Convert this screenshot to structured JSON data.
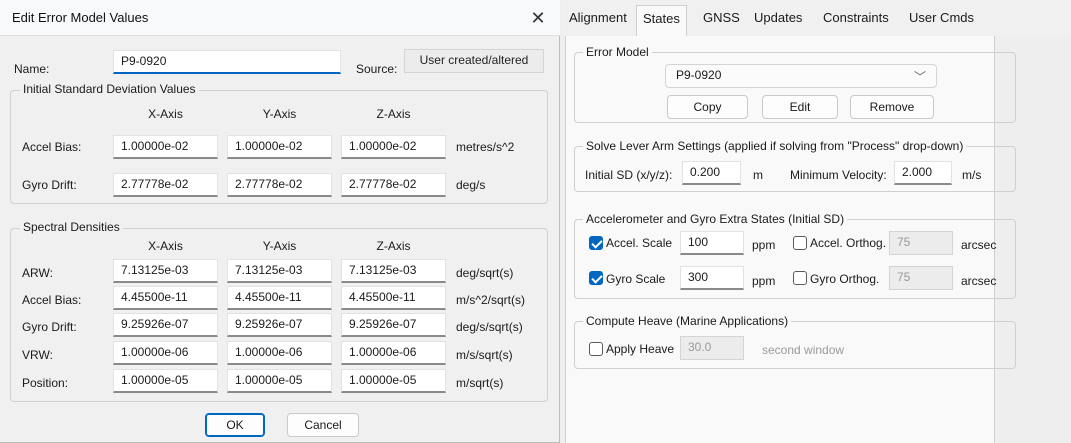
{
  "dialog": {
    "title": "Edit Error Model Values",
    "close_glyph": "✕",
    "name_label": "Name:",
    "name_value": "P9-0920",
    "source_label": "Source:",
    "source_value": "User created/altered",
    "initial_sd": {
      "group_title": "Initial Standard Deviation Values",
      "col_headers": [
        "X-Axis",
        "Y-Axis",
        "Z-Axis"
      ],
      "rows": [
        {
          "label": "Accel Bias:",
          "x": "1.00000e-02",
          "y": "1.00000e-02",
          "z": "1.00000e-02",
          "unit": "metres/s^2"
        },
        {
          "label": "Gyro Drift:",
          "x": "2.77778e-02",
          "y": "2.77778e-02",
          "z": "2.77778e-02",
          "unit": "deg/s"
        }
      ]
    },
    "spectral": {
      "group_title": "Spectral Densities",
      "col_headers": [
        "X-Axis",
        "Y-Axis",
        "Z-Axis"
      ],
      "rows": [
        {
          "label": "ARW:",
          "x": "7.13125e-03",
          "y": "7.13125e-03",
          "z": "7.13125e-03",
          "unit": "deg/sqrt(s)"
        },
        {
          "label": "Accel Bias:",
          "x": "4.45500e-11",
          "y": "4.45500e-11",
          "z": "4.45500e-11",
          "unit": "m/s^2/sqrt(s)"
        },
        {
          "label": "Gyro Drift:",
          "x": "9.25926e-07",
          "y": "9.25926e-07",
          "z": "9.25926e-07",
          "unit": "deg/s/sqrt(s)"
        },
        {
          "label": "VRW:",
          "x": "1.00000e-06",
          "y": "1.00000e-06",
          "z": "1.00000e-06",
          "unit": "m/s/sqrt(s)"
        },
        {
          "label": "Position:",
          "x": "1.00000e-05",
          "y": "1.00000e-05",
          "z": "1.00000e-05",
          "unit": "m/sqrt(s)"
        }
      ]
    },
    "ok_label": "OK",
    "cancel_label": "Cancel"
  },
  "tabs": [
    "Alignment",
    "States",
    "GNSS",
    "Updates",
    "Constraints",
    "User Cmds"
  ],
  "active_tab": "States",
  "error_model": {
    "group_title": "Error Model",
    "selected": "P9-0920",
    "copy_label": "Copy",
    "edit_label": "Edit",
    "remove_label": "Remove"
  },
  "lever_arm": {
    "group_title": "Solve Lever Arm Settings (applied if solving from \"Process\" drop-down)",
    "initial_sd_label": "Initial SD (x/y/z):",
    "initial_sd_value": "0.200",
    "initial_sd_unit": "m",
    "min_vel_label": "Minimum Velocity:",
    "min_vel_value": "2.000",
    "min_vel_unit": "m/s"
  },
  "extra_states": {
    "group_title": "Accelerometer and Gyro Extra States (Initial SD)",
    "accel_scale_label": "Accel. Scale",
    "accel_scale_checked": true,
    "accel_scale_value": "100",
    "accel_scale_unit": "ppm",
    "accel_orthog_label": "Accel. Orthog.",
    "accel_orthog_checked": false,
    "accel_orthog_value": "75",
    "accel_orthog_unit": "arcsec",
    "gyro_scale_label": "Gyro Scale",
    "gyro_scale_checked": true,
    "gyro_scale_value": "300",
    "gyro_scale_unit": "ppm",
    "gyro_orthog_label": "Gyro Orthog.",
    "gyro_orthog_checked": false,
    "gyro_orthog_value": "75",
    "gyro_orthog_unit": "arcsec"
  },
  "heave": {
    "group_title": "Compute Heave (Marine Applications)",
    "apply_label": "Apply Heave",
    "apply_checked": false,
    "value": "30.0",
    "unit": "second window"
  },
  "colors": {
    "accent": "#0067c0",
    "dialog_bg": "#f0f0f0",
    "panel_bg": "#f9f9f9"
  }
}
